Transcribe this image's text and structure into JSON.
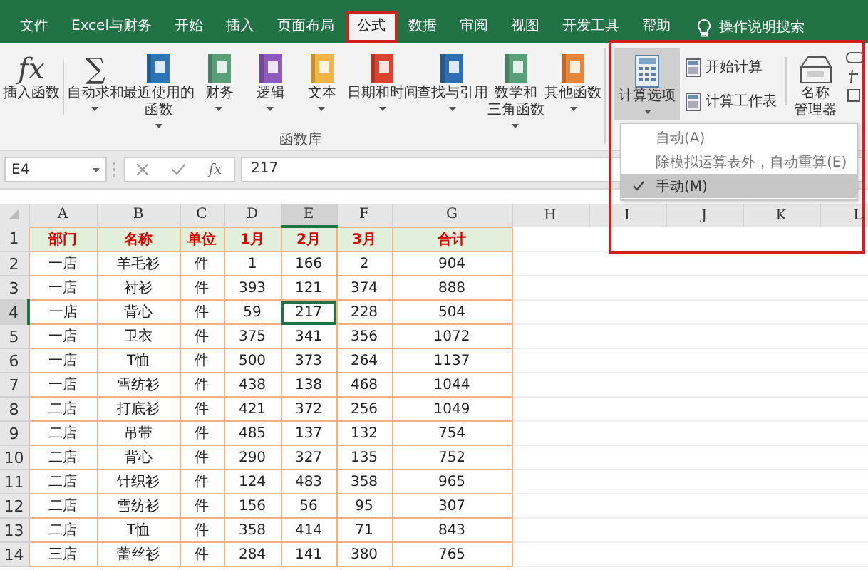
{
  "tabs": [
    {
      "label": "文件",
      "selected": false
    },
    {
      "label": "Excel与财务",
      "selected": false
    },
    {
      "label": "开始",
      "selected": false
    },
    {
      "label": "插入",
      "selected": false
    },
    {
      "label": "页面布局",
      "selected": false
    },
    {
      "label": "公式",
      "selected": true
    },
    {
      "label": "数据",
      "selected": false
    },
    {
      "label": "审阅",
      "selected": false
    },
    {
      "label": "视图",
      "selected": false
    },
    {
      "label": "开发工具",
      "selected": false
    },
    {
      "label": "帮助",
      "selected": false
    }
  ],
  "tell_me": "操作说明搜索",
  "function_library": {
    "group_label": "函数库",
    "items": [
      {
        "kind": "glyph",
        "glyph": "fx",
        "lines": [
          "插入函数"
        ],
        "dropdown": false
      },
      {
        "kind": "glyph",
        "glyph": "∑",
        "lines": [
          "自动求和"
        ],
        "dropdown": true
      },
      {
        "kind": "book",
        "color": "#2e75b6",
        "lines": [
          "最近使用的",
          "函数"
        ],
        "dropdown": true
      },
      {
        "kind": "book",
        "color": "#5b9f7a",
        "lines": [
          "财务"
        ],
        "dropdown": true
      },
      {
        "kind": "book",
        "color": "#8e5bbd",
        "lines": [
          "逻辑"
        ],
        "dropdown": true
      },
      {
        "kind": "book",
        "color": "#f2b544",
        "lines": [
          "文本"
        ],
        "dropdown": true
      },
      {
        "kind": "book",
        "color": "#d9432f",
        "lines": [
          "日期和时间"
        ],
        "dropdown": true
      },
      {
        "kind": "book",
        "color": "#2f6fb0",
        "lines": [
          "查找与引用"
        ],
        "dropdown": true
      },
      {
        "kind": "book",
        "color": "#5b9f7a",
        "lines": [
          "数学和",
          "三角函数"
        ],
        "dropdown": true
      },
      {
        "kind": "book",
        "color": "#e8873a",
        "lines": [
          "其他函数"
        ],
        "dropdown": true
      }
    ]
  },
  "calculation": {
    "options_button": {
      "label": "计算选项",
      "pressed": true
    },
    "small_buttons": [
      "开始计算",
      "计算工作表"
    ],
    "name_manager": [
      "名称",
      "管理器"
    ]
  },
  "calc_menu": [
    {
      "label": "自动(A)",
      "checked": false
    },
    {
      "label": "除模拟运算表外，自动重算(E)",
      "checked": false
    },
    {
      "label": "手动(M)",
      "checked": true
    }
  ],
  "formula_bar": {
    "name_box": "E4",
    "fx": "fx",
    "value": "217"
  },
  "sheet": {
    "columns": [
      {
        "label": "A",
        "selected": false
      },
      {
        "label": "B",
        "selected": false
      },
      {
        "label": "C",
        "selected": false
      },
      {
        "label": "D",
        "selected": false
      },
      {
        "label": "E",
        "selected": true
      },
      {
        "label": "F",
        "selected": false
      },
      {
        "label": "G",
        "selected": false
      },
      {
        "label": "H",
        "selected": false
      },
      {
        "label": "I",
        "selected": false
      },
      {
        "label": "J",
        "selected": false
      },
      {
        "label": "K",
        "selected": false
      },
      {
        "label": "L",
        "selected": false
      }
    ],
    "rows": [
      {
        "n": "1",
        "selected": false,
        "cells": [
          "部门",
          "名称",
          "单位",
          "1月",
          "2月",
          "3月",
          "合计"
        ]
      },
      {
        "n": "2",
        "selected": false,
        "cells": [
          "一店",
          "羊毛衫",
          "件",
          "1",
          "166",
          "2",
          "904"
        ]
      },
      {
        "n": "3",
        "selected": false,
        "cells": [
          "一店",
          "衬衫",
          "件",
          "393",
          "121",
          "374",
          "888"
        ]
      },
      {
        "n": "4",
        "selected": true,
        "cells": [
          "一店",
          "背心",
          "件",
          "59",
          "217",
          "228",
          "504"
        ]
      },
      {
        "n": "5",
        "selected": false,
        "cells": [
          "一店",
          "卫衣",
          "件",
          "375",
          "341",
          "356",
          "1072"
        ]
      },
      {
        "n": "6",
        "selected": false,
        "cells": [
          "一店",
          "T恤",
          "件",
          "500",
          "373",
          "264",
          "1137"
        ]
      },
      {
        "n": "7",
        "selected": false,
        "cells": [
          "一店",
          "雪纺衫",
          "件",
          "438",
          "138",
          "468",
          "1044"
        ]
      },
      {
        "n": "8",
        "selected": false,
        "cells": [
          "二店",
          "打底衫",
          "件",
          "421",
          "372",
          "256",
          "1049"
        ]
      },
      {
        "n": "9",
        "selected": false,
        "cells": [
          "二店",
          "吊带",
          "件",
          "485",
          "137",
          "132",
          "754"
        ]
      },
      {
        "n": "10",
        "selected": false,
        "cells": [
          "二店",
          "背心",
          "件",
          "290",
          "327",
          "135",
          "752"
        ]
      },
      {
        "n": "11",
        "selected": false,
        "cells": [
          "二店",
          "针织衫",
          "件",
          "124",
          "483",
          "358",
          "965"
        ]
      },
      {
        "n": "12",
        "selected": false,
        "cells": [
          "二店",
          "雪纺衫",
          "件",
          "156",
          "56",
          "95",
          "307"
        ]
      },
      {
        "n": "13",
        "selected": false,
        "cells": [
          "二店",
          "T恤",
          "件",
          "358",
          "414",
          "71",
          "843"
        ]
      },
      {
        "n": "14",
        "selected": false,
        "cells": [
          "三店",
          "蕾丝衫",
          "件",
          "284",
          "141",
          "380",
          "765"
        ]
      }
    ]
  }
}
